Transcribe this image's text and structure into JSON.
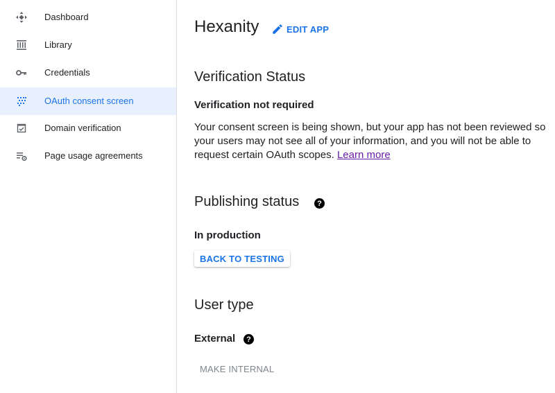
{
  "sidebar": {
    "items": [
      {
        "label": "Dashboard",
        "icon": "dashboard-icon",
        "active": false
      },
      {
        "label": "Library",
        "icon": "library-icon",
        "active": false
      },
      {
        "label": "Credentials",
        "icon": "key-icon",
        "active": false
      },
      {
        "label": "OAuth consent screen",
        "icon": "oauth-consent-icon",
        "active": true
      },
      {
        "label": "Domain verification",
        "icon": "domain-verification-icon",
        "active": false
      },
      {
        "label": "Page usage agreements",
        "icon": "settings-list-icon",
        "active": false
      }
    ]
  },
  "header": {
    "app_name": "Hexanity",
    "edit_label": "EDIT APP"
  },
  "verification": {
    "title": "Verification Status",
    "status": "Verification not required",
    "description": "Your consent screen is being shown, but your app has not been reviewed so your users may not see all of your information, and you will not be able to request certain OAuth scopes.",
    "learn_more": "Learn more"
  },
  "publishing": {
    "title": "Publishing status",
    "status": "In production",
    "button_label": "BACK TO TESTING"
  },
  "user_type": {
    "title": "User type",
    "value": "External",
    "button_label": "MAKE INTERNAL"
  },
  "colors": {
    "accent": "#1a73e8",
    "active_bg": "#e8f0fe",
    "link_visited": "#681da8"
  }
}
